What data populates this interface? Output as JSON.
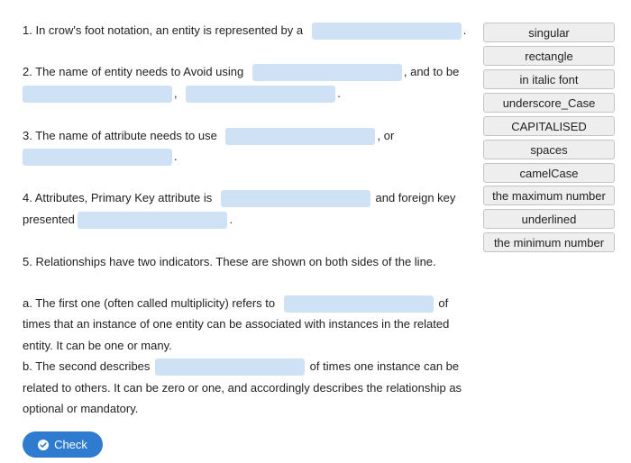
{
  "questions": {
    "q1": {
      "text": "1. In crow's foot notation, an entity is represented by a",
      "end": "."
    },
    "q2": {
      "line1": "2. The name of entity needs to Avoid using",
      "mid": ", and to be",
      "sep": ",",
      "end": "."
    },
    "q3": {
      "line1": "3. The name of attribute needs to use",
      "mid": ", or",
      "end": "."
    },
    "q4": {
      "line1": "4. Attributes, Primary Key attribute is",
      "mid": "and foreign key",
      "line2": "presented",
      "end": "."
    },
    "q5": {
      "intro": "5. Relationships have two indicators. These are shown on both sides of the line.",
      "a_start": "a. The first one (often called multiplicity) refers to",
      "a_of": "of",
      "a_line2": "times that an instance of one entity can be associated with instances in the related",
      "a_line3": "entity. It can be  one or many.",
      "b_start": "b. The second describes",
      "b_mid": "of times one instance can be",
      "b_line2": "related to others. It can be zero or one, and accordingly describes the relationship as",
      "b_line3": "optional or mandatory."
    }
  },
  "options": [
    "singular",
    "rectangle",
    "in italic font",
    "underscore_Case",
    "CAPITALISED",
    "spaces",
    "camelCase",
    "the maximum number",
    "underlined",
    "the minimum number"
  ],
  "check_button": {
    "label": "Check"
  },
  "colors": {
    "blank": "#cfe2f5",
    "button": "#2f7bd0",
    "option_bg": "#eeeeee"
  }
}
